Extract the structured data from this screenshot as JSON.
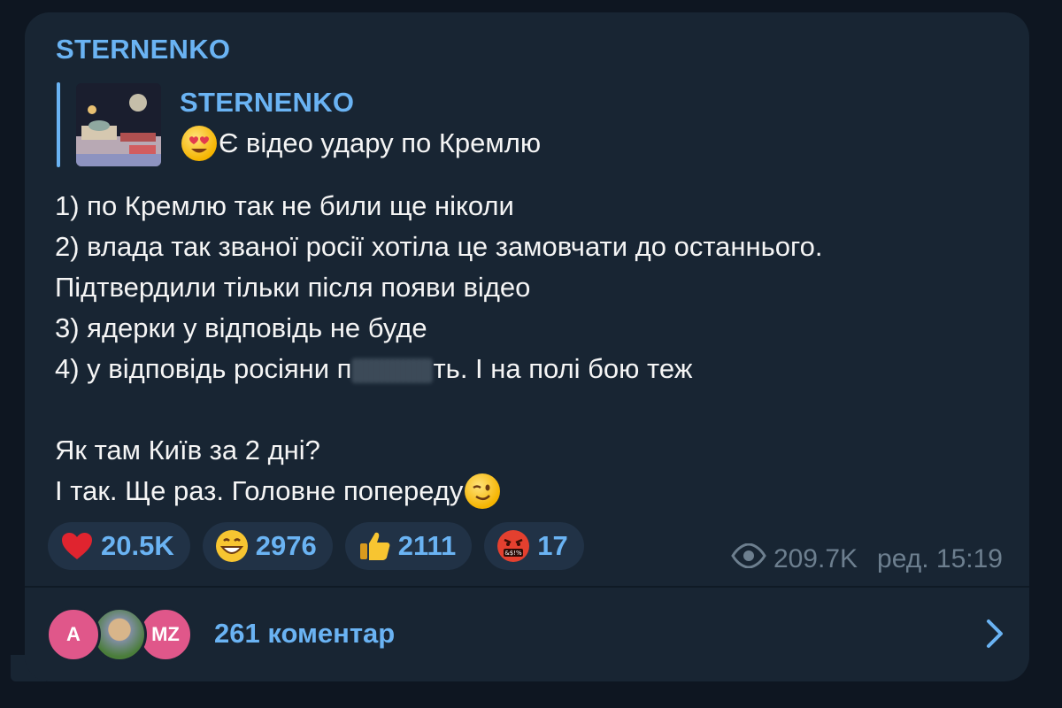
{
  "post": {
    "channel_name": "STERNENKO",
    "forward": {
      "title": "STERNENKO",
      "text": "Є відео удару по Кремлю",
      "emoji_icon": "heart-eyes-emoji"
    },
    "body_lines": [
      "1) по Кремлю так не били ще ніколи",
      "2) влада так званої росії хотіла це замовчати до останнього.",
      "Підтвердили тільки після появи відео",
      "3) ядерки у відповідь не буде"
    ],
    "line4": {
      "before": "4) у відповідь росіяни п",
      "after": "ть. І на полі бою теж"
    },
    "after_lines": [
      "Як там Київ за 2 дні?"
    ],
    "last_line": "І так. Ще раз. Головне попереду",
    "last_emoji": "winking-face-emoji"
  },
  "reactions": [
    {
      "icon": "red-heart-icon",
      "count": "20.5K"
    },
    {
      "icon": "grinning-face-icon",
      "count": "2976"
    },
    {
      "icon": "thumbs-up-icon",
      "count": "2111"
    },
    {
      "icon": "cursing-face-icon",
      "count": "17"
    }
  ],
  "meta": {
    "views": "209.7K",
    "edited_time": "ред. 15:19"
  },
  "comments": {
    "avatars": [
      "A",
      "MZ"
    ],
    "label": "261 коментар"
  },
  "colors": {
    "background": "#0e1621",
    "bubble": "#182533",
    "accent": "#6ab3f3",
    "text": "#f5f5f5",
    "meta": "#6d7f8f",
    "reaction_bg": "#213246"
  }
}
